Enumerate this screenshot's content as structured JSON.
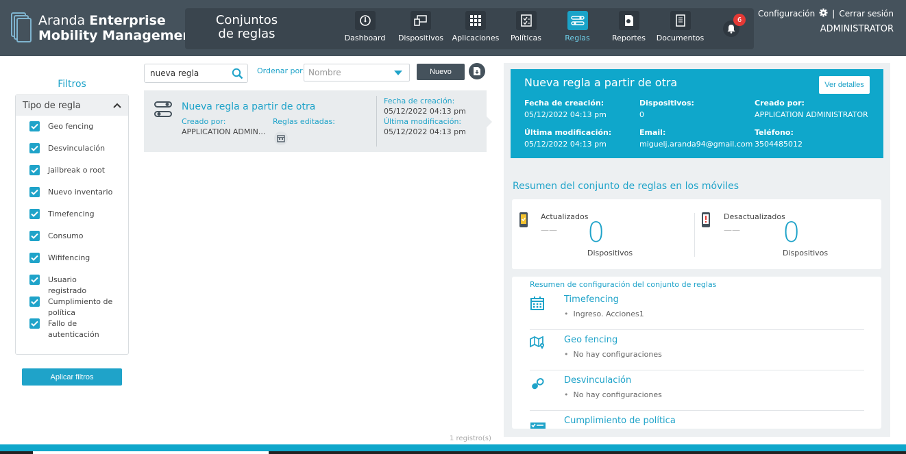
{
  "brand": {
    "line1_light": "Aranda ",
    "line1_bold": "Enterprise",
    "line2": "Mobility Management"
  },
  "module_title": "Conjuntos de reglas",
  "nav": [
    {
      "label": "Dashboard",
      "icon": "dashboard-icon"
    },
    {
      "label": "Dispositivos",
      "icon": "devices-icon"
    },
    {
      "label": "Aplicaciones",
      "icon": "apps-grid-icon"
    },
    {
      "label": "Políticas",
      "icon": "policies-icon"
    },
    {
      "label": "Reglas",
      "icon": "rules-icon",
      "active": true
    },
    {
      "label": "Reportes",
      "icon": "reports-icon"
    },
    {
      "label": "Documentos",
      "icon": "documents-icon"
    }
  ],
  "notifications_count": "6",
  "top_links": {
    "config": "Configuración",
    "logout": "Cerrar sesión"
  },
  "user": "ADMINISTRATOR",
  "filters": {
    "title": "Filtros",
    "group": "Tipo de regla",
    "items": [
      "Geo fencing",
      "Desvinculación",
      "Jailbreak o root",
      "Nuevo inventario",
      "Timefencing",
      "Consumo",
      "Wififencing",
      "Usuario registrado",
      "Cumplimiento de política",
      "Fallo de autenticación"
    ],
    "apply": "Aplicar filtros"
  },
  "search": {
    "value": "nueva regla"
  },
  "sort": {
    "label": "Ordenar por:",
    "placeholder": "Nombre"
  },
  "new_button": "Nuevo",
  "card": {
    "title": "Nueva regla a partir de otra",
    "created_by_label": "Creado por:",
    "created_by_value": "APPLICATION ADMIN...",
    "edited_rules_label": "Reglas editadas:",
    "creation_label": "Fecha de creación:",
    "creation_value": "05/12/2022 04:13 pm",
    "modified_label": "Última modificación:",
    "modified_value": "05/12/2022 04:13 pm"
  },
  "record_count": "1 registro(s)",
  "detail": {
    "title": "Nueva regla a partir de otra",
    "view_button": "Ver detalles",
    "fields": [
      {
        "label": "Fecha de creación:",
        "value": "05/12/2022 04:13 pm"
      },
      {
        "label": "Dispositivos:",
        "value": "0"
      },
      {
        "label": "Creado por:",
        "value": "APPLICATION ADMINISTRATOR"
      },
      {
        "label": "Última modificación:",
        "value": "05/12/2022 04:13 pm"
      },
      {
        "label": "Email:",
        "value": "miguelj.aranda94@gmail.com"
      },
      {
        "label": "Teléfono:",
        "value": "3504485012"
      }
    ]
  },
  "summary": {
    "title": "Resumen del conjunto de reglas en los móviles",
    "updated_label": "Actualizados",
    "updated_count": "0",
    "outdated_label": "Desactualizados",
    "outdated_count": "0",
    "unit": "Dispositivos",
    "dash": "——"
  },
  "config": {
    "title": "Resumen de configuración del conjunto de reglas",
    "rows": [
      {
        "name": "Timefencing",
        "detail": "Ingreso. Acciones1",
        "icon": "calendar-icon"
      },
      {
        "name": "Geo fencing",
        "detail": "No hay configuraciones",
        "icon": "map-pin-icon"
      },
      {
        "name": "Desvinculación",
        "detail": "No hay configuraciones",
        "icon": "unlink-icon"
      },
      {
        "name": "Cumplimiento de política",
        "detail": "",
        "icon": "policy-check-icon"
      }
    ]
  },
  "colors": {
    "accent": "#1fa3c9",
    "header": "#45525c",
    "detail_bg": "#0fa7cb"
  }
}
